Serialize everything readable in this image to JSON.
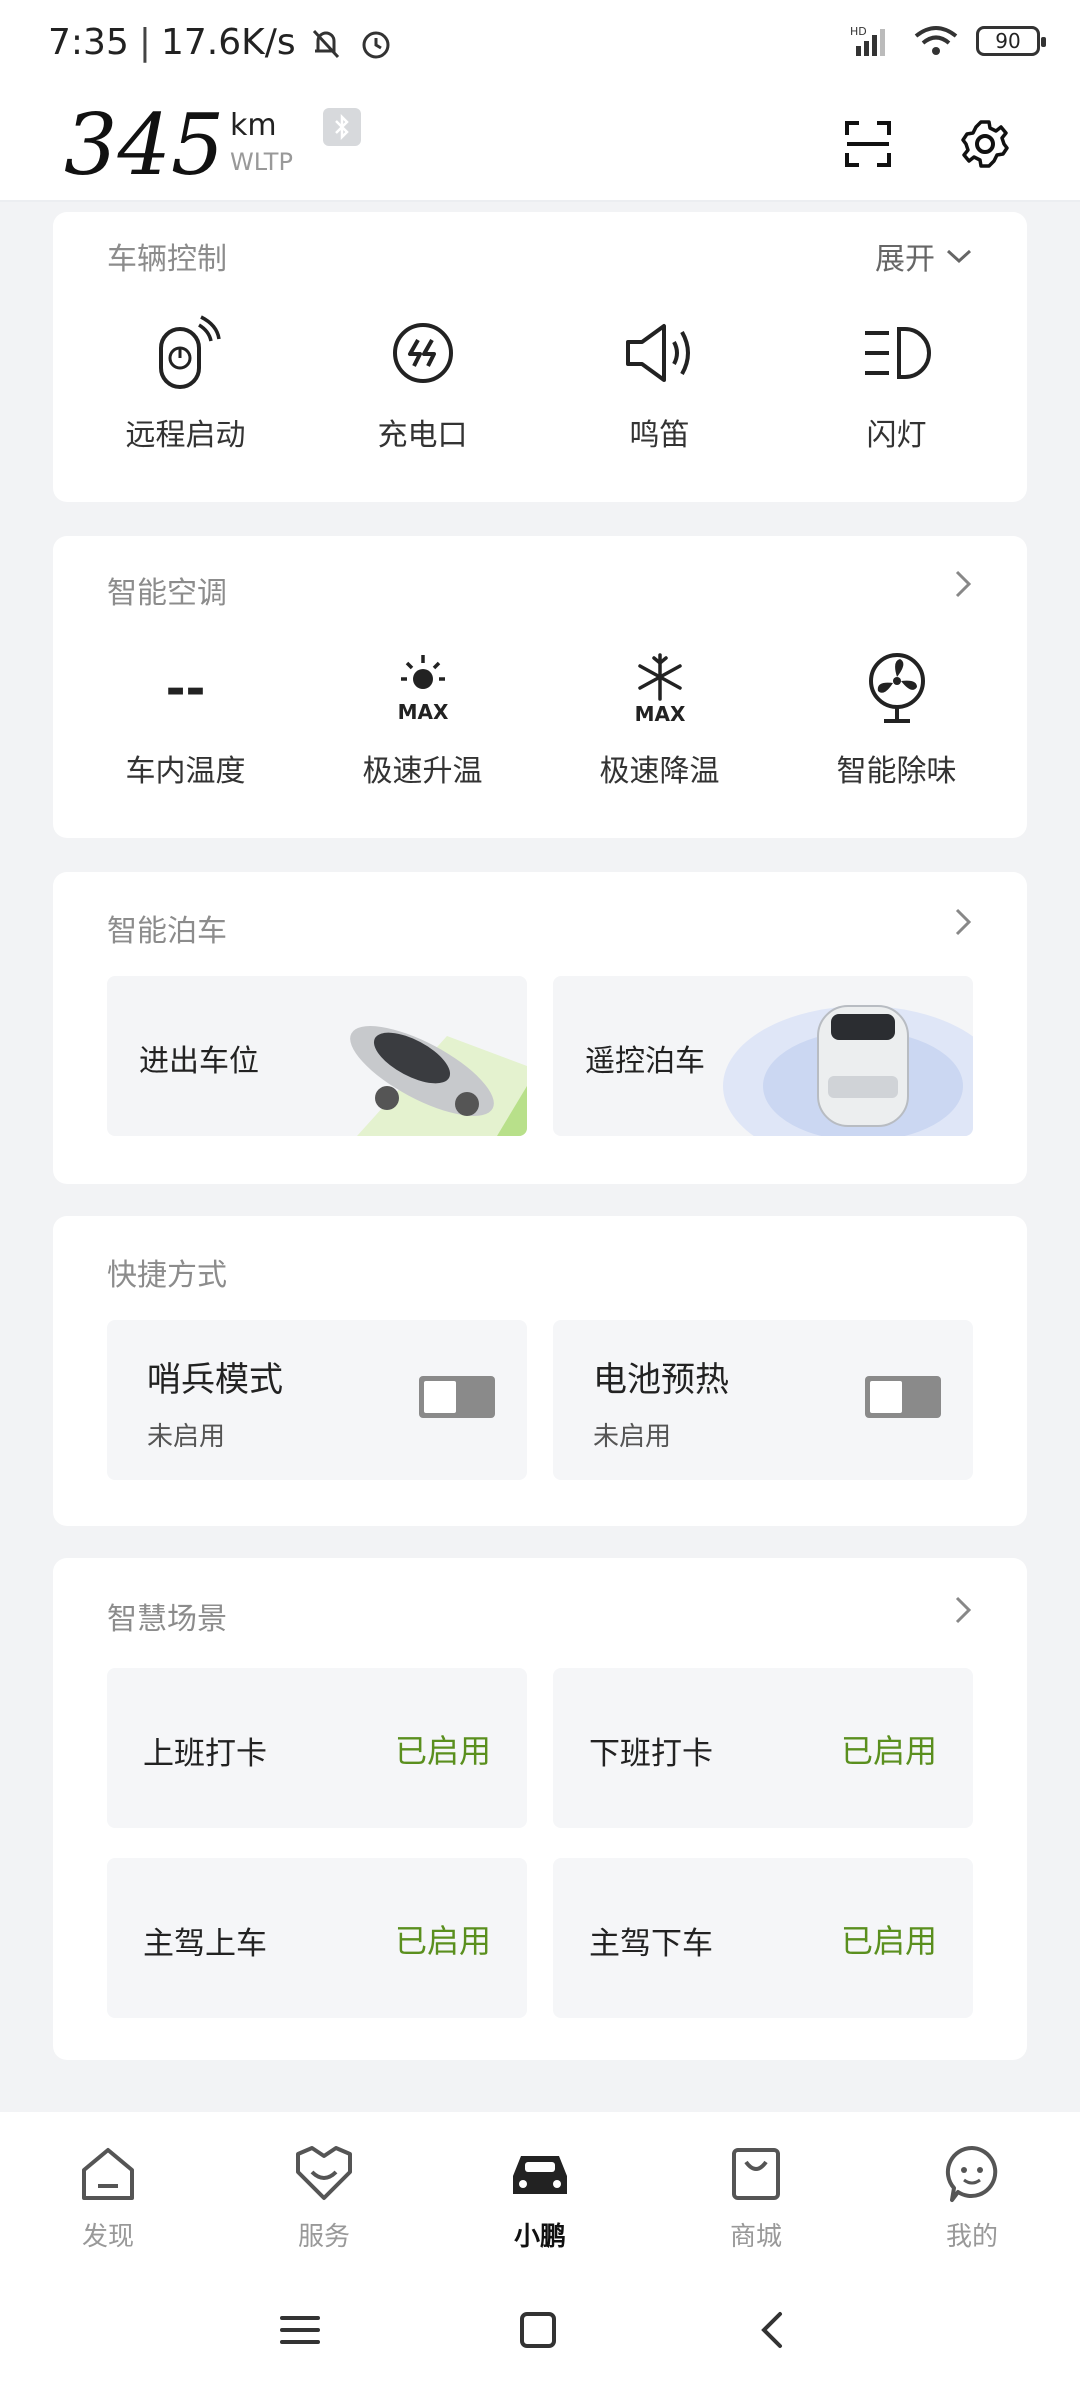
{
  "status": {
    "time": "7:35",
    "speed": "17.6K/s",
    "network": "HD",
    "battery": "90"
  },
  "header": {
    "range_value": "345",
    "range_unit": "km",
    "range_standard": "WLTP"
  },
  "vehicle_control": {
    "title": "车辆控制",
    "expand_label": "展开",
    "items": [
      {
        "label": "远程启动",
        "icon": "remote-start-icon"
      },
      {
        "label": "充电口",
        "icon": "charge-port-icon"
      },
      {
        "label": "鸣笛",
        "icon": "horn-icon"
      },
      {
        "label": "闪灯",
        "icon": "flash-lights-icon"
      }
    ]
  },
  "climate": {
    "title": "智能空调",
    "temp_value": "--",
    "items": [
      {
        "label": "车内温度"
      },
      {
        "label": "极速升温",
        "icon_text": "MAX"
      },
      {
        "label": "极速降温",
        "icon_text": "MAX"
      },
      {
        "label": "智能除味"
      }
    ]
  },
  "parking": {
    "title": "智能泊车",
    "items": [
      {
        "label": "进出车位"
      },
      {
        "label": "遥控泊车"
      }
    ]
  },
  "shortcuts": {
    "title": "快捷方式",
    "items": [
      {
        "label": "哨兵模式",
        "status": "未启用"
      },
      {
        "label": "电池预热",
        "status": "未启用"
      }
    ]
  },
  "scenes": {
    "title": "智慧场景",
    "items": [
      {
        "label": "上班打卡",
        "status": "已启用"
      },
      {
        "label": "下班打卡",
        "status": "已启用"
      },
      {
        "label": "主驾上车",
        "status": "已启用"
      },
      {
        "label": "主驾下车",
        "status": "已启用"
      }
    ]
  },
  "nav": {
    "items": [
      {
        "label": "发现"
      },
      {
        "label": "服务"
      },
      {
        "label": "小鹏"
      },
      {
        "label": "商城"
      },
      {
        "label": "我的"
      }
    ]
  },
  "colors": {
    "accent_green": "#5a8f1e",
    "background": "#f2f3f5"
  }
}
